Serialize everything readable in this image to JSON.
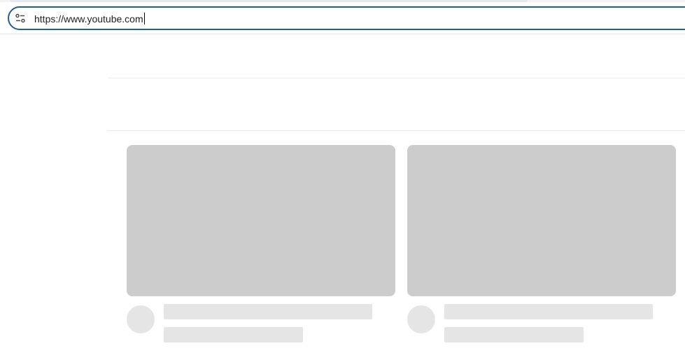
{
  "address_bar": {
    "url": "https://www.youtube.com",
    "site_info_icon": "tune-icon"
  },
  "colors": {
    "omnibox_border": "#1f5f96",
    "thumbnail_placeholder": "#cccccc",
    "text_placeholder": "#e5e5e5"
  },
  "video_grid": {
    "state": "loading",
    "cards": [
      {
        "placeholder": true
      },
      {
        "placeholder": true
      }
    ]
  }
}
